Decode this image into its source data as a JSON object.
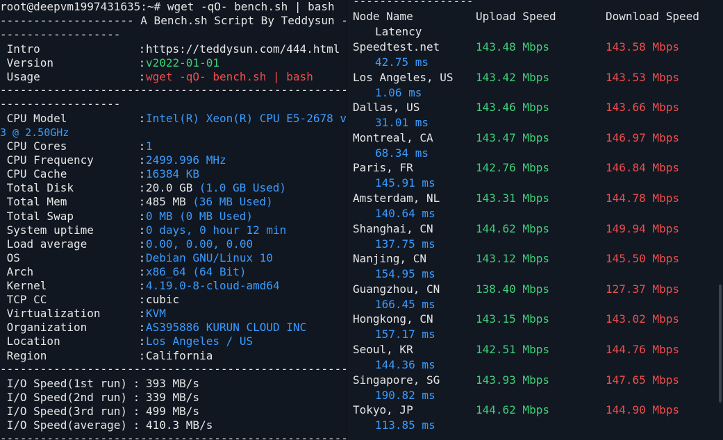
{
  "left": {
    "prompt": "root@deepvm1997431635:~# wget -qO- bench.sh | bash",
    "banner": "-------------------- A Bench.sh Script By Teddysun -",
    "dashes_short": "------------------",
    "dashes_long": "----------------------------------------------------",
    "rows": [
      {
        "label": " Intro",
        "sep": " : ",
        "value": "https://teddysun.com/444.html",
        "color": "white"
      },
      {
        "label": " Version",
        "sep": " : ",
        "value": "v2022-01-01",
        "color": "green"
      },
      {
        "label": " Usage",
        "sep": " : ",
        "value": "wget -qO- bench.sh | bash",
        "color": "red"
      }
    ],
    "cpu_model": {
      "label": " CPU Model",
      "sep": " : ",
      "value": "Intel(R) Xeon(R) CPU E5-2678 v",
      "wrap": "3 @ 2.50GHz"
    },
    "sys_rows": [
      {
        "label": " CPU Cores",
        "value": "1",
        "extra": ""
      },
      {
        "label": " CPU Frequency",
        "value": "2499.996 MHz",
        "extra": ""
      },
      {
        "label": " CPU Cache",
        "value": "16384 KB",
        "extra": ""
      },
      {
        "label": " Total Disk",
        "value": "20.0 GB",
        "extra": "(1.0 GB Used)",
        "value_color": "white"
      },
      {
        "label": " Total Mem",
        "value": "485 MB",
        "extra": "(36 MB Used)",
        "value_color": "white"
      },
      {
        "label": " Total Swap",
        "value": "0 MB",
        "extra": "(0 MB Used)"
      },
      {
        "label": " System uptime",
        "value": "0 days, 0 hour 12 min",
        "extra": ""
      },
      {
        "label": " Load average",
        "value": "0.00, 0.00, 0.00",
        "extra": ""
      },
      {
        "label": " OS",
        "value": "Debian GNU/Linux 10",
        "extra": ""
      },
      {
        "label": " Arch",
        "value": "x86_64 (64 Bit)",
        "extra": ""
      },
      {
        "label": " Kernel",
        "value": "4.19.0-8-cloud-amd64",
        "extra": ""
      },
      {
        "label": " TCP CC",
        "value": "cubic",
        "extra": "",
        "value_color": "white"
      },
      {
        "label": " Virtualization",
        "value": "KVM",
        "extra": ""
      },
      {
        "label": " Organization",
        "value": "AS395886 KURUN CLOUD INC",
        "extra": ""
      },
      {
        "label": " Location",
        "value": "Los Angeles / US",
        "extra": ""
      },
      {
        "label": " Region",
        "value": "California",
        "extra": "",
        "value_color": "white"
      }
    ],
    "io_rows": [
      {
        "label": " I/O Speed(1st run)",
        "value": "393 MB/s"
      },
      {
        "label": " I/O Speed(2nd run)",
        "value": "339 MB/s"
      },
      {
        "label": " I/O Speed(3rd run)",
        "value": "499 MB/s"
      },
      {
        "label": " I/O Speed(average)",
        "value": "410.3 MB/s"
      }
    ]
  },
  "right": {
    "top_dashes": "------------------",
    "headers": {
      "node": "Node Name",
      "upload": "Upload Speed",
      "download": "Download Speed",
      "latency": "Latency"
    },
    "nodes": [
      {
        "name": "Speedtest.net",
        "upload": "143.48 Mbps",
        "download": "143.58 Mbps",
        "latency": "42.75 ms"
      },
      {
        "name": "Los Angeles, US",
        "upload": "143.42 Mbps",
        "download": "143.53 Mbps",
        "latency": "1.06 ms"
      },
      {
        "name": "Dallas, US",
        "upload": "143.46 Mbps",
        "download": "143.66 Mbps",
        "latency": "31.01 ms"
      },
      {
        "name": "Montreal, CA",
        "upload": "143.47 Mbps",
        "download": "146.97 Mbps",
        "latency": "68.34 ms"
      },
      {
        "name": "Paris, FR",
        "upload": "142.76 Mbps",
        "download": "146.84 Mbps",
        "latency": "145.91 ms"
      },
      {
        "name": "Amsterdam, NL",
        "upload": "143.31 Mbps",
        "download": "144.78 Mbps",
        "latency": "140.64 ms"
      },
      {
        "name": "Shanghai, CN",
        "upload": "144.62 Mbps",
        "download": "149.94 Mbps",
        "latency": "137.75 ms"
      },
      {
        "name": "Nanjing, CN",
        "upload": "143.12 Mbps",
        "download": "145.50 Mbps",
        "latency": "154.95 ms"
      },
      {
        "name": "Guangzhou, CN",
        "upload": "138.40 Mbps",
        "download": "127.37 Mbps",
        "latency": "166.45 ms"
      },
      {
        "name": "Hongkong, CN",
        "upload": "143.15 Mbps",
        "download": "143.02 Mbps",
        "latency": "157.17 ms"
      },
      {
        "name": "Seoul, KR",
        "upload": "142.51 Mbps",
        "download": "144.76 Mbps",
        "latency": "144.36 ms"
      },
      {
        "name": "Singapore, SG",
        "upload": "143.93 Mbps",
        "download": "147.65 Mbps",
        "latency": "190.82 ms"
      },
      {
        "name": "Tokyo, JP",
        "upload": "144.62 Mbps",
        "download": "144.90 Mbps",
        "latency": "113.85 ms"
      }
    ]
  },
  "colors": {
    "bg": "#111720",
    "green": "#3ed07a",
    "red": "#f14c4c",
    "blue": "#3a9bff",
    "text": "#e6e6e6"
  }
}
